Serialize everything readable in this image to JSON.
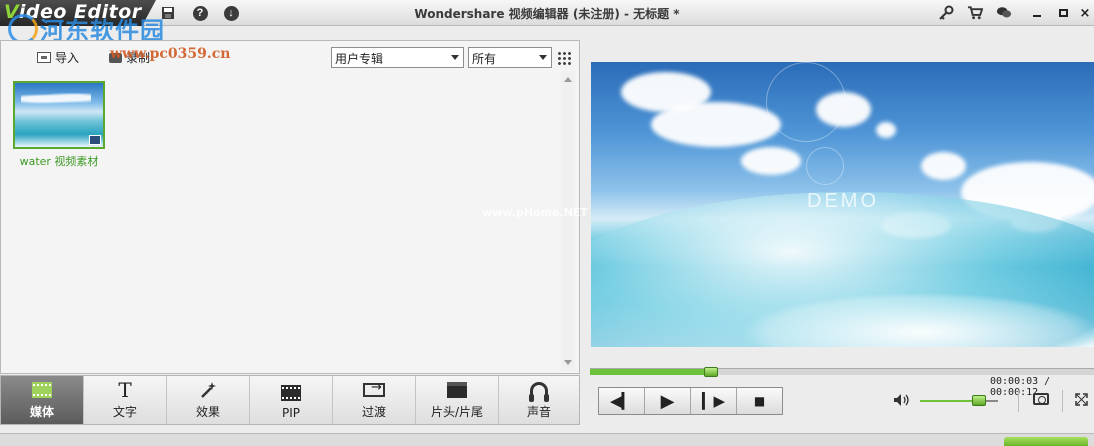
{
  "titlebar": {
    "app_name_first": "V",
    "app_name_rest": "ideo Editor",
    "title": "Wondershare 视频编辑器 (未注册) - 无标题 *",
    "watermark_text": "河东软件园",
    "watermark_url": "www.pc0359.cn"
  },
  "toolbar": {
    "import_label": "导入",
    "record_label": "录制",
    "album_select": "用户专辑",
    "filter_select": "所有"
  },
  "media": {
    "items": [
      {
        "label": "water 视频素材"
      }
    ]
  },
  "tabs": [
    {
      "label": "媒体",
      "icon": "film-icon",
      "active": true
    },
    {
      "label": "文字",
      "icon": "text-icon",
      "active": false
    },
    {
      "label": "效果",
      "icon": "wand-icon",
      "active": false
    },
    {
      "label": "PIP",
      "icon": "film-icon",
      "active": false
    },
    {
      "label": "过渡",
      "icon": "transition-icon",
      "active": false
    },
    {
      "label": "片头/片尾",
      "icon": "clapper-icon",
      "active": false
    },
    {
      "label": "声音",
      "icon": "headphone-icon",
      "active": false
    }
  ],
  "preview": {
    "demo_text": "DEMO",
    "video_watermark": "www.pHome.NET",
    "current_time": "00:00:03",
    "total_time": "00:00:12",
    "timecode": "00:00:03 / 00:00:12",
    "progress": 0.24,
    "volume": 0.75
  },
  "colors": {
    "accent_green": "#6cc238",
    "titlebar_dark": "#262626"
  }
}
